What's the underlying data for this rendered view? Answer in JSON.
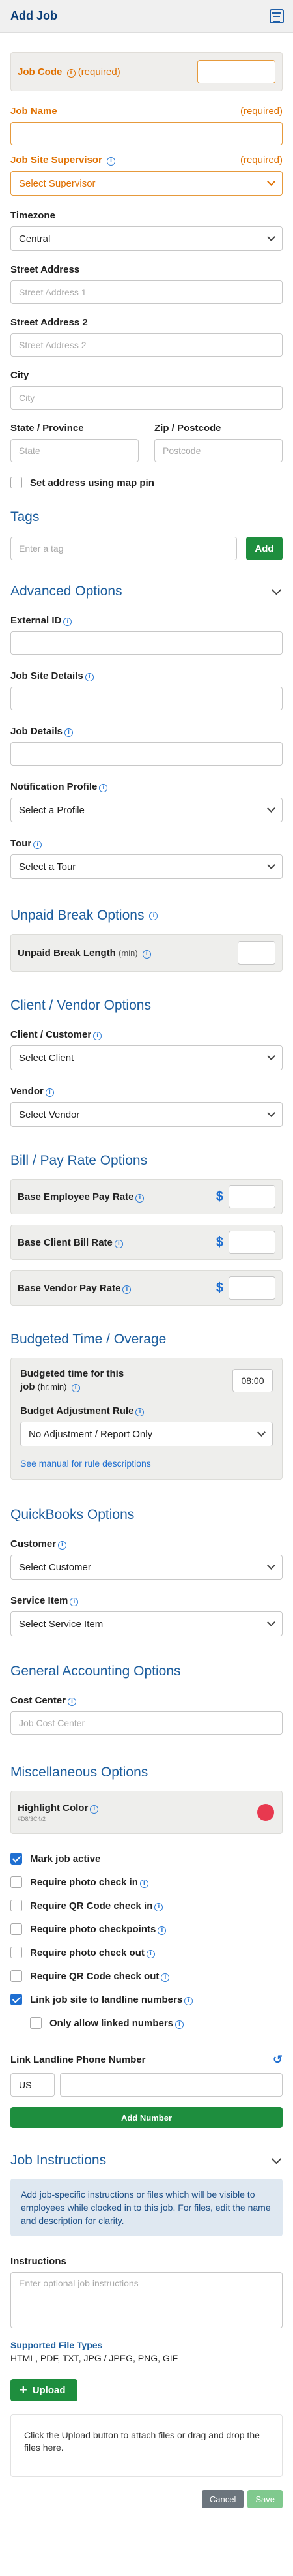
{
  "header": {
    "title": "Add Job",
    "icon": "calendar-icon"
  },
  "job_code": {
    "label": "Job Code",
    "required": "(required)"
  },
  "job_name": {
    "label": "Job Name",
    "required": "(required)"
  },
  "supervisor": {
    "label": "Job Site Supervisor",
    "required": "(required)",
    "value": "Select Supervisor"
  },
  "timezone": {
    "label": "Timezone",
    "value": "Central"
  },
  "street": {
    "label": "Street Address",
    "placeholder": "Street Address 1"
  },
  "street2": {
    "label": "Street Address 2",
    "placeholder": "Street Address 2"
  },
  "city": {
    "label": "City",
    "placeholder": "City"
  },
  "state": {
    "label": "State / Province",
    "placeholder": "State"
  },
  "zip": {
    "label": "Zip / Postcode",
    "placeholder": "Postcode"
  },
  "map_pin": {
    "label": "Set address using map pin"
  },
  "tags": {
    "title": "Tags",
    "placeholder": "Enter a tag",
    "add": "Add"
  },
  "advanced": {
    "title": "Advanced Options",
    "external_id": "External ID",
    "site_details": "Job Site Details",
    "job_details": "Job Details",
    "notification_profile": {
      "label": "Notification Profile",
      "value": "Select a Profile"
    },
    "tour": {
      "label": "Tour",
      "value": "Select a Tour"
    }
  },
  "unpaid_break": {
    "title": "Unpaid Break Options",
    "label": "Unpaid Break Length",
    "unit": "(min)"
  },
  "client_vendor": {
    "title": "Client / Vendor Options",
    "client_label": "Client / Customer",
    "client_value": "Select Client",
    "vendor_label": "Vendor",
    "vendor_value": "Select Vendor"
  },
  "pay_rate": {
    "title": "Bill / Pay Rate Options",
    "rows": [
      {
        "label": "Base Employee Pay Rate",
        "symbol": "$"
      },
      {
        "label": "Base Client Bill Rate",
        "symbol": "$"
      },
      {
        "label": "Base Vendor Pay Rate",
        "symbol": "$"
      }
    ]
  },
  "budget": {
    "title": "Budgeted Time / Overage",
    "time_label_1": "Budgeted time for this",
    "time_label_2": "job",
    "time_unit": "(hr:min)",
    "time_value": "08:00",
    "rule_label": "Budget Adjustment Rule",
    "rule_value": "No Adjustment / Report Only",
    "manual_link": "See manual for rule descriptions"
  },
  "quickbooks": {
    "title": "QuickBooks Options",
    "customer_label": "Customer",
    "customer_value": "Select Customer",
    "service_label": "Service Item",
    "service_value": "Select Service Item"
  },
  "accounting": {
    "title": "General Accounting Options",
    "cost_center": "Cost Center",
    "placeholder": "Job Cost Center"
  },
  "misc": {
    "title": "Miscellaneous Options",
    "highlight_label": "Highlight Color",
    "highlight_hex": "#D8/3C4/2",
    "highlight_color": "#e8394f",
    "checks": [
      {
        "label": "Mark job active",
        "checked": true
      },
      {
        "label": "Require photo check in",
        "checked": false
      },
      {
        "label": "Require QR Code check in",
        "checked": false
      },
      {
        "label": "Require photo checkpoints",
        "checked": false
      },
      {
        "label": "Require photo check out",
        "checked": false
      },
      {
        "label": "Require QR Code check out",
        "checked": false
      },
      {
        "label": "Link job site to landline numbers",
        "checked": true
      },
      {
        "label": "Only allow linked numbers",
        "checked": false
      }
    ],
    "landline_label": "Link Landline Phone Number",
    "country": "US",
    "add_number": "Add Number"
  },
  "instructions": {
    "title": "Job Instructions",
    "notice": "Add job-specific instructions or files which will be visible to employees while clocked in to this job. For files, edit the name and description for clarity.",
    "label": "Instructions",
    "placeholder": "Enter optional job instructions",
    "file_types_label": "Supported File Types",
    "file_types": "HTML, PDF, TXT, JPG / JPEG, PNG, GIF",
    "upload": "Upload",
    "drop_text": "Click the Upload button to attach files or drag and drop the files here."
  },
  "footer": {
    "cancel": "Cancel",
    "save": "Save"
  }
}
